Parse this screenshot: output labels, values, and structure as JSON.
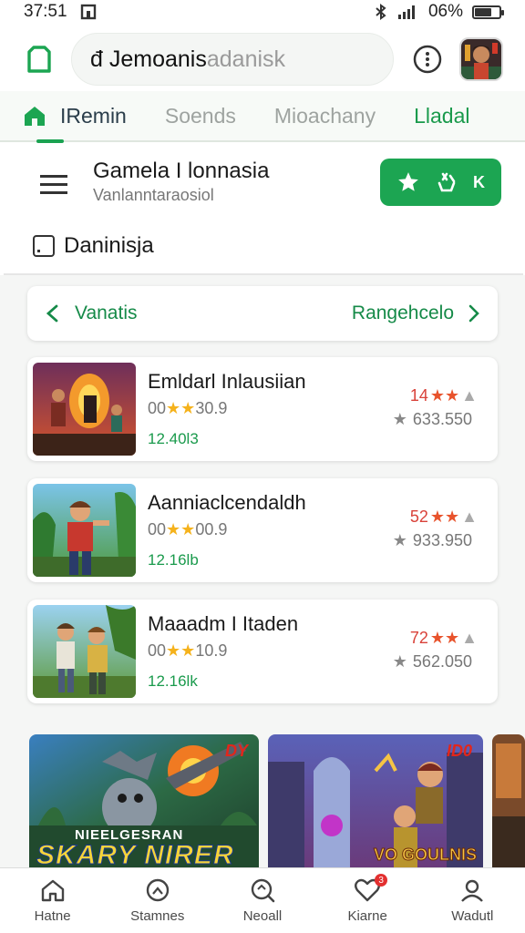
{
  "status_bar": {
    "time": "37:51",
    "battery": "06%",
    "battery_level": 0.7
  },
  "search": {
    "typed": "đ Jemoanis",
    "placeholder": "adanisk"
  },
  "tabs": [
    {
      "label": "IRemin"
    },
    {
      "label": "Soends"
    },
    {
      "label": "Mioachany"
    },
    {
      "label": "Lladal"
    }
  ],
  "header": {
    "title": "Gamela I lonnasia",
    "subtitle": "Vanlanntaraosiol",
    "button_label": "K",
    "section_label": "Daninisja"
  },
  "filter": {
    "left_label": "Vanatis",
    "right_label": "Rangehcelo"
  },
  "games": [
    {
      "title": "Emldarl Inlausiian",
      "rating_prefix": "00",
      "rating_value": "30.9",
      "size": "12.40l3",
      "score": "14",
      "score_stars": 2,
      "downloads": "633.550",
      "thumb": "volcano"
    },
    {
      "title": "Aanniaclcendaldh",
      "rating_prefix": "00",
      "rating_value": "00.9",
      "size": "12.16lb",
      "score": "52",
      "score_stars": 2,
      "downloads": "933.950",
      "thumb": "jungle"
    },
    {
      "title": "Maaadm I Itaden",
      "rating_prefix": "00",
      "rating_value": "10.9",
      "size": "12.16lk",
      "score": "72",
      "score_stars": 2,
      "downloads": "562.050",
      "thumb": "forest"
    }
  ],
  "banners": [
    {
      "title": "SKARY NIRER",
      "subtitle": "NIEELGESRAN",
      "label": "DY"
    },
    {
      "title": "VO GOULNIS",
      "label": "ID0"
    }
  ],
  "bottom_nav": [
    {
      "label": "Hatne",
      "icon": "home-icon"
    },
    {
      "label": "Stamnes",
      "icon": "controller-icon"
    },
    {
      "label": "Neoall",
      "icon": "search-icon"
    },
    {
      "label": "Kiarne",
      "icon": "heart-icon",
      "badge": "3"
    },
    {
      "label": "Wadutl",
      "icon": "profile-icon"
    }
  ],
  "colors": {
    "accent": "#1ca552",
    "star": "#f5b21c",
    "score": "#d9423a"
  }
}
